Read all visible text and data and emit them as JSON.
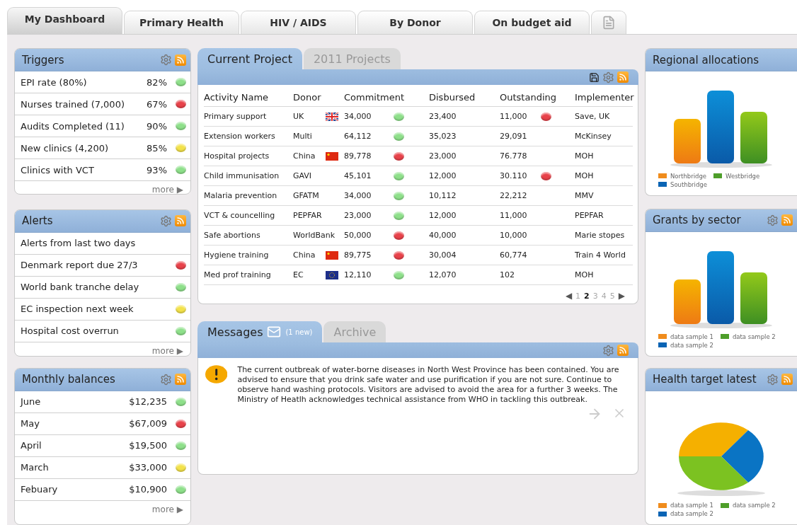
{
  "tabs": [
    {
      "kind": "text",
      "label": "My Dashboard",
      "selected": true
    },
    {
      "kind": "text",
      "label": "Primary Health",
      "selected": false
    },
    {
      "kind": "text",
      "label": "HIV / AIDS",
      "selected": false
    },
    {
      "kind": "text",
      "label": "By Donor",
      "selected": false
    },
    {
      "kind": "text",
      "label": "On budget aid",
      "selected": false
    },
    {
      "kind": "icon",
      "selected": false
    }
  ],
  "triggers": {
    "title": "Triggers",
    "more": "more ▶",
    "rows": [
      {
        "label": "EPI rate (80%)",
        "value": "82%",
        "color": "#8ee08a"
      },
      {
        "label": "Nurses trained (7,000)",
        "value": "67%",
        "color": "#e8424a"
      },
      {
        "label": "Audits Completed (11)",
        "value": "90%",
        "color": "#8ee08a"
      },
      {
        "label": "New clinics (4,200)",
        "value": "85%",
        "color": "#f3e24a"
      },
      {
        "label": "Clinics with VCT",
        "value": "93%",
        "color": "#8ee08a"
      }
    ]
  },
  "alerts": {
    "title": "Alerts",
    "more": "more ▶",
    "rows": [
      {
        "label": "Alerts from last two days"
      },
      {
        "label": "Denmark report due 27/3",
        "color": "#e8424a"
      },
      {
        "label": "World bank tranche delay",
        "color": "#8ee08a"
      },
      {
        "label": "EC inspection next week",
        "color": "#f3e24a"
      },
      {
        "label": "Hospital cost overrun",
        "color": "#8ee08a"
      }
    ]
  },
  "balances": {
    "title": "Monthly balances",
    "more": "more ▶",
    "rows": [
      {
        "label": "June",
        "value": "$12,235",
        "color": "#8ee08a"
      },
      {
        "label": "May",
        "value": "$67,009",
        "color": "#e8424a"
      },
      {
        "label": "April",
        "value": "$19,500",
        "color": "#8ee08a"
      },
      {
        "label": "March",
        "value": "$33,000",
        "color": "#f3e24a"
      },
      {
        "label": "Febuary",
        "value": "$10,900",
        "color": "#8ee08a"
      }
    ]
  },
  "projects": {
    "tabs": [
      {
        "label": "Current Project",
        "selected": true
      },
      {
        "label": "2011 Projects",
        "selected": false
      }
    ],
    "columns": [
      "Activity Name",
      "Donor",
      "Commitment",
      "Disbursed",
      "Outstanding",
      "Implementer"
    ],
    "rows": [
      {
        "activity": "Primary support",
        "donor": {
          "text": "UK",
          "flag": {
            "kind": "uk"
          }
        },
        "commitment": {
          "text": "34,000",
          "color": "#8ee08a"
        },
        "disbursed": "23,400",
        "outstanding": {
          "text": "11,000",
          "color": "#e8424a"
        },
        "implementer": "Save, UK"
      },
      {
        "activity": "Extension workers",
        "donor": {
          "text": "Multi"
        },
        "commitment": {
          "text": "64,112",
          "color": "#8ee08a"
        },
        "disbursed": "35,023",
        "outstanding": {
          "text": "29,091"
        },
        "implementer": "McKinsey"
      },
      {
        "activity": "Hospital projects",
        "donor": {
          "text": "China",
          "flag": {
            "kind": "china"
          }
        },
        "commitment": {
          "text": "89,778",
          "color": "#e8424a"
        },
        "disbursed": "23,000",
        "outstanding": {
          "text": "76.778"
        },
        "implementer": "MOH"
      },
      {
        "activity": "Child immunisation",
        "donor": {
          "text": "GAVI"
        },
        "commitment": {
          "text": "45,101",
          "color": "#8ee08a"
        },
        "disbursed": "12,000",
        "outstanding": {
          "text": "30.110",
          "color": "#e8424a"
        },
        "implementer": "MOH"
      },
      {
        "activity": "Malaria prevention",
        "donor": {
          "text": "GFATM"
        },
        "commitment": {
          "text": "34,000",
          "color": "#8ee08a"
        },
        "disbursed": "10,112",
        "outstanding": {
          "text": "22,212"
        },
        "implementer": "MMV"
      },
      {
        "activity": "VCT & councelling",
        "donor": {
          "text": "PEPFAR"
        },
        "commitment": {
          "text": "23,000",
          "color": "#8ee08a"
        },
        "disbursed": "12,000",
        "outstanding": {
          "text": "11,000"
        },
        "implementer": "PEPFAR"
      },
      {
        "activity": "Safe abortions",
        "donor": {
          "text": "WorldBank"
        },
        "commitment": {
          "text": "50,000",
          "color": "#e8424a"
        },
        "disbursed": "40,000",
        "outstanding": {
          "text": "10,000"
        },
        "implementer": "Marie stopes"
      },
      {
        "activity": "Hygiene training",
        "donor": {
          "text": "China",
          "flag": {
            "kind": "china"
          }
        },
        "commitment": {
          "text": "89,775",
          "color": "#e8424a"
        },
        "disbursed": "30,004",
        "outstanding": {
          "text": "60,774"
        },
        "implementer": "Train 4 World"
      },
      {
        "activity": "Med prof training",
        "donor": {
          "text": "EC",
          "flag": {
            "kind": "eu"
          }
        },
        "commitment": {
          "text": "12,110",
          "color": "#8ee08a"
        },
        "disbursed": "12,070",
        "outstanding": {
          "text": "102"
        },
        "implementer": "MOH"
      }
    ],
    "pager": {
      "prev": "◀",
      "next": "▶",
      "pages": [
        {
          "label": "1",
          "selected": false
        },
        {
          "label": "2",
          "selected": true
        },
        {
          "label": "3",
          "selected": false
        },
        {
          "label": "4",
          "selected": false
        },
        {
          "label": "5",
          "selected": false
        }
      ]
    }
  },
  "messages": {
    "tabs": [
      {
        "label": "Messages",
        "badge": "(1 new)",
        "selected": true
      },
      {
        "label": "Archive",
        "selected": false
      }
    ],
    "text": "The current outbreak of water-borne diseases in North West Province has been contained. You are advised to ensure that you drink safe water and use purification if you are not sure. Continue to observe hand washing protocols.  Visitors are advised to avoid the area for a further 3 weeks. The Ministry of Heatlh acknowledges technical assistance from WHO in tackling this outbreak."
  },
  "regional": {
    "title": "Regional allocations",
    "kind": "bar",
    "legend": [
      {
        "label": "Northbridge",
        "color": "#f08c1c"
      },
      {
        "label": "Westbridge",
        "color": "#4e9e2a"
      },
      {
        "label": "Southbridge",
        "color": "#0a64b4"
      }
    ]
  },
  "grants": {
    "title": "Grants by sector",
    "kind": "bar",
    "legend": [
      {
        "label": "data sample 1",
        "color": "#f08c1c"
      },
      {
        "label": "data sample 2",
        "color": "#4e9e2a"
      },
      {
        "label": "data sample 2",
        "color": "#0a64b4"
      }
    ]
  },
  "health": {
    "title": "Health target latest",
    "kind": "pie",
    "legend": [
      {
        "label": "data sample 1",
        "color": "#f08c1c"
      },
      {
        "label": "data sample 2",
        "color": "#4e9e2a"
      },
      {
        "label": "data sample 2",
        "color": "#0a64b4"
      }
    ]
  }
}
